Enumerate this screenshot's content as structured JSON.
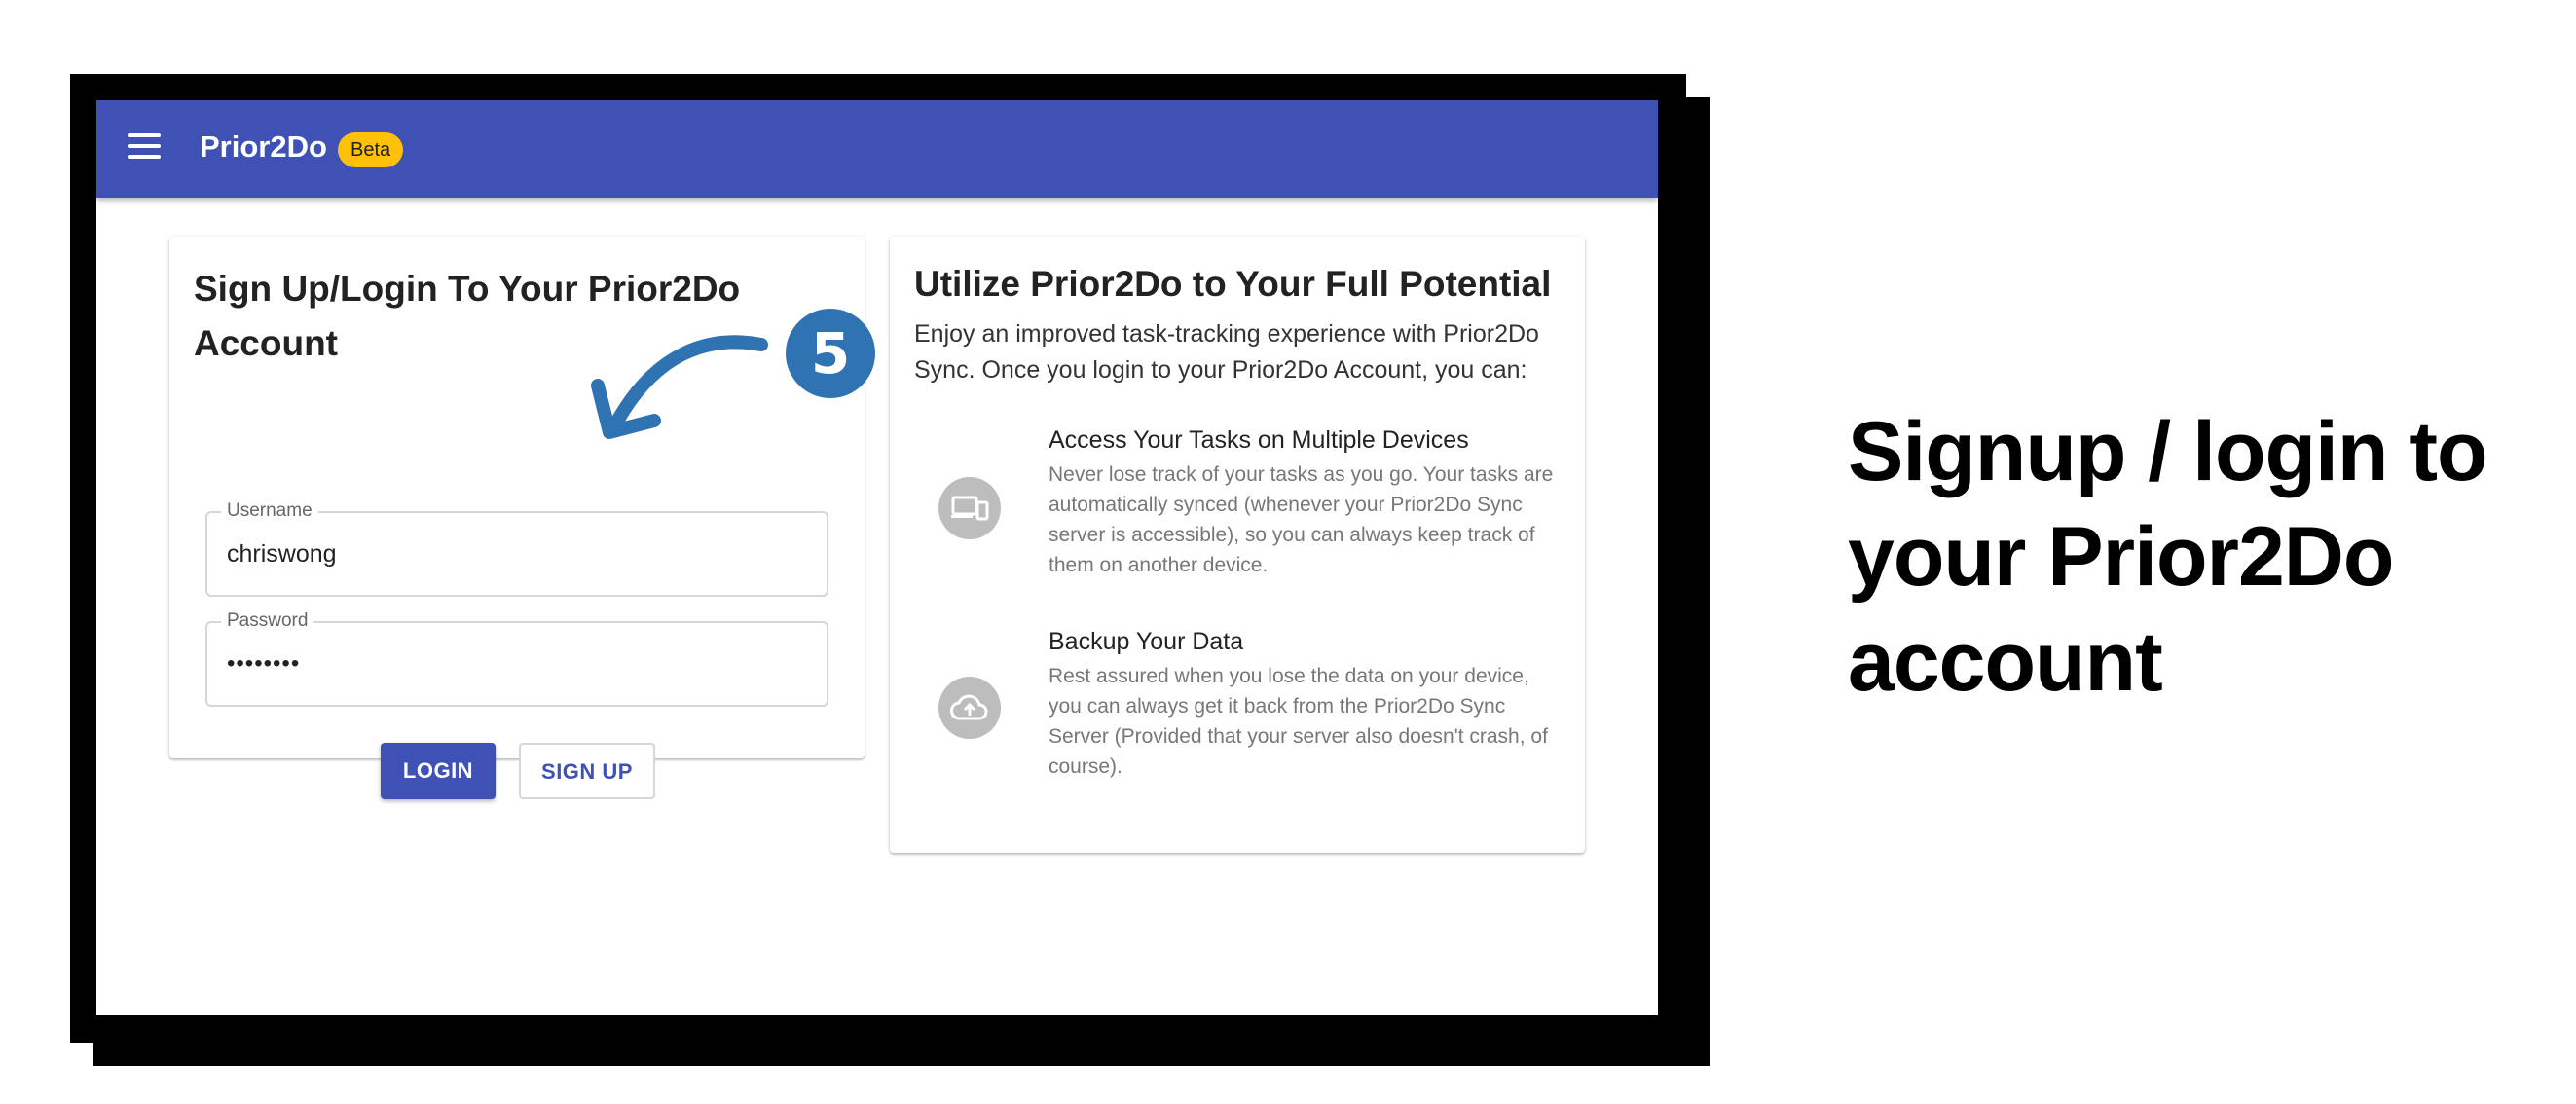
{
  "appbar": {
    "title": "Prior2Do",
    "badge": "Beta",
    "menu_icon": "hamburger-menu-icon",
    "color": "#3f51b5",
    "badge_color": "#ffc107"
  },
  "login_card": {
    "title": "Sign Up/Login To Your Prior2Do Account",
    "username_label": "Username",
    "username_value": "chriswong",
    "password_label": "Password",
    "password_value": "••••••••",
    "login_button": "LOGIN",
    "signup_button": "SIGN UP"
  },
  "info_card": {
    "title": "Utilize Prior2Do to Your Full Potential",
    "description": "Enjoy an improved task-tracking experience with Prior2Do Sync. Once you login to your Prior2Do Account, you can:",
    "features": [
      {
        "title": "Access Your Tasks on Multiple Devices",
        "text": "Never lose track of your tasks as you go. Your tasks are automatically synced (whenever your Prior2Do Sync server is accessible), so you can always keep track of them on another device.",
        "icon": "devices-icon"
      },
      {
        "title": "Backup Your Data",
        "text": "Rest assured when you lose the data on your device, you can always get it back from the Prior2Do Sync Server (Provided that your server also doesn't crash, of course).",
        "icon": "cloud-upload-icon"
      }
    ]
  },
  "callout": {
    "step_number": "5",
    "color": "#2f73b3"
  },
  "caption": {
    "text": "Signup / login to your Prior2Do account"
  }
}
